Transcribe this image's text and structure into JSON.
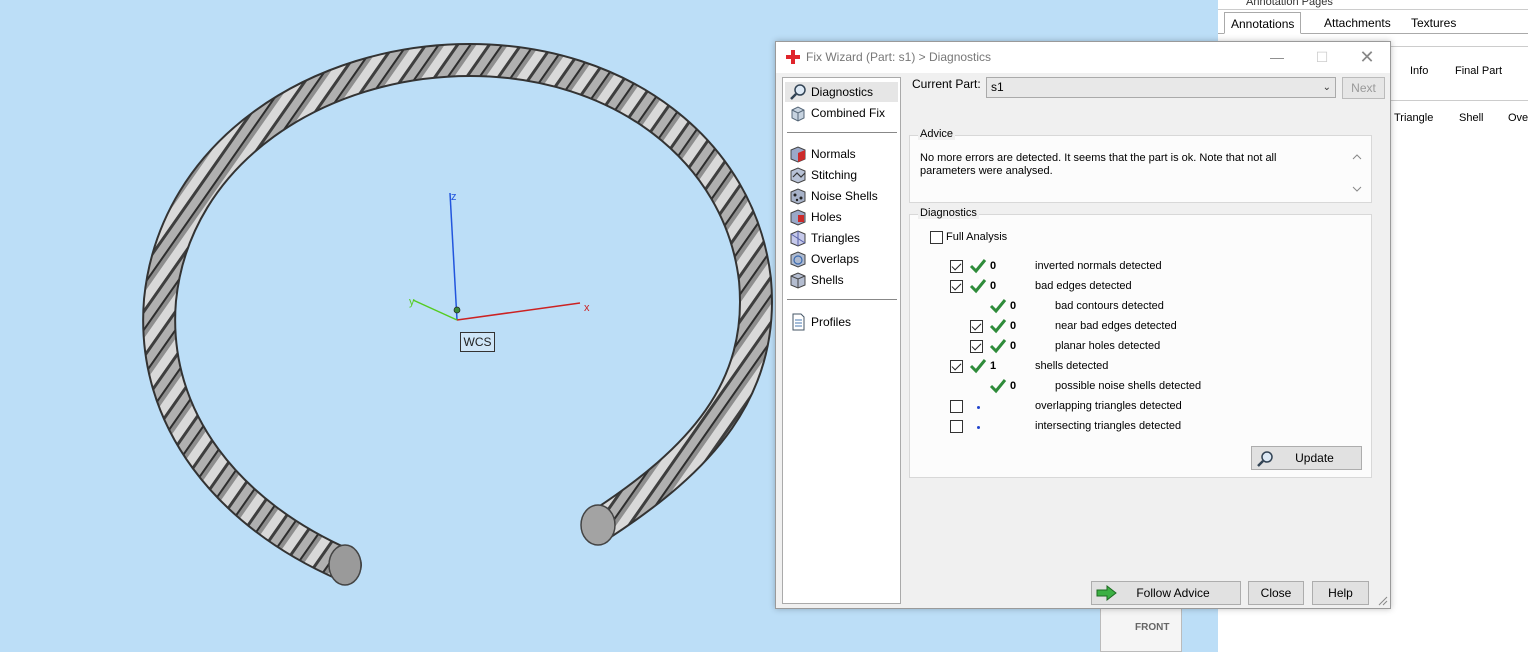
{
  "viewport": {
    "wcs_label": "WCS",
    "axes": {
      "x": "x",
      "y": "y",
      "z": "z"
    },
    "view_cube_label": "FRONT"
  },
  "right_panel": {
    "top_text": "Annotation Pages",
    "tabs": [
      "Annotations",
      "Attachments",
      "Textures"
    ],
    "row2": [
      "Info",
      "Final Part"
    ],
    "row3": [
      "Triangle",
      "Shell",
      "Ove"
    ]
  },
  "dialog": {
    "title": "Fix Wizard (Part: s1) > Diagnostics",
    "nav": {
      "group1": [
        "Diagnostics",
        "Combined Fix"
      ],
      "group2": [
        "Normals",
        "Stitching",
        "Noise Shells",
        "Holes",
        "Triangles",
        "Overlaps",
        "Shells"
      ],
      "group3": [
        "Profiles"
      ]
    },
    "current_part_label": "Current Part:",
    "current_part_value": "s1",
    "next_label": "Next",
    "advice": {
      "title": "Advice",
      "text": "No more errors are detected. It seems that the part is ok. Note that not all parameters were analysed."
    },
    "diagnostics": {
      "title": "Diagnostics",
      "full_analysis_label": "Full Analysis",
      "rows": [
        {
          "count": "0",
          "label": "inverted normals detected"
        },
        {
          "count": "0",
          "label": "bad edges detected"
        },
        {
          "count": "0",
          "label": "bad contours detected"
        },
        {
          "count": "0",
          "label": "near bad edges detected"
        },
        {
          "count": "0",
          "label": "planar holes detected"
        },
        {
          "count": "1",
          "label": "shells detected"
        },
        {
          "count": "0",
          "label": "possible noise shells detected"
        },
        {
          "count": "",
          "label": "overlapping triangles detected"
        },
        {
          "count": "",
          "label": "intersecting triangles detected"
        }
      ],
      "update_label": "Update"
    },
    "buttons": {
      "follow_advice": "Follow Advice",
      "close": "Close",
      "help": "Help"
    }
  },
  "colors": {
    "viewport_bg": "#bcdef7",
    "check_green": "#2e8b3a",
    "x_axis": "#cc2222",
    "y_axis": "#55cc22",
    "z_axis": "#2255dd"
  }
}
